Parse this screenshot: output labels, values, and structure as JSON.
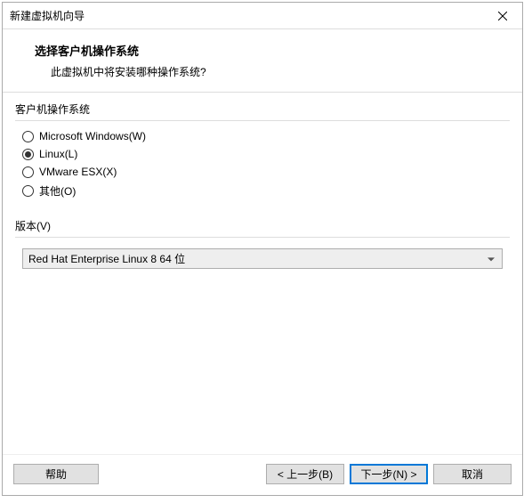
{
  "titlebar": {
    "title": "新建虚拟机向导"
  },
  "header": {
    "title": "选择客户机操作系统",
    "subtitle": "此虚拟机中将安装哪种操作系统?"
  },
  "os_group": {
    "label": "客户机操作系统",
    "options": [
      {
        "label": "Microsoft Windows(W)",
        "selected": false
      },
      {
        "label": "Linux(L)",
        "selected": true
      },
      {
        "label": "VMware ESX(X)",
        "selected": false
      },
      {
        "label": "其他(O)",
        "selected": false
      }
    ]
  },
  "version": {
    "label": "版本(V)",
    "selected": "Red Hat Enterprise Linux 8 64 位"
  },
  "footer": {
    "help": "帮助",
    "back": "< 上一步(B)",
    "next": "下一步(N) >",
    "cancel": "取消"
  }
}
